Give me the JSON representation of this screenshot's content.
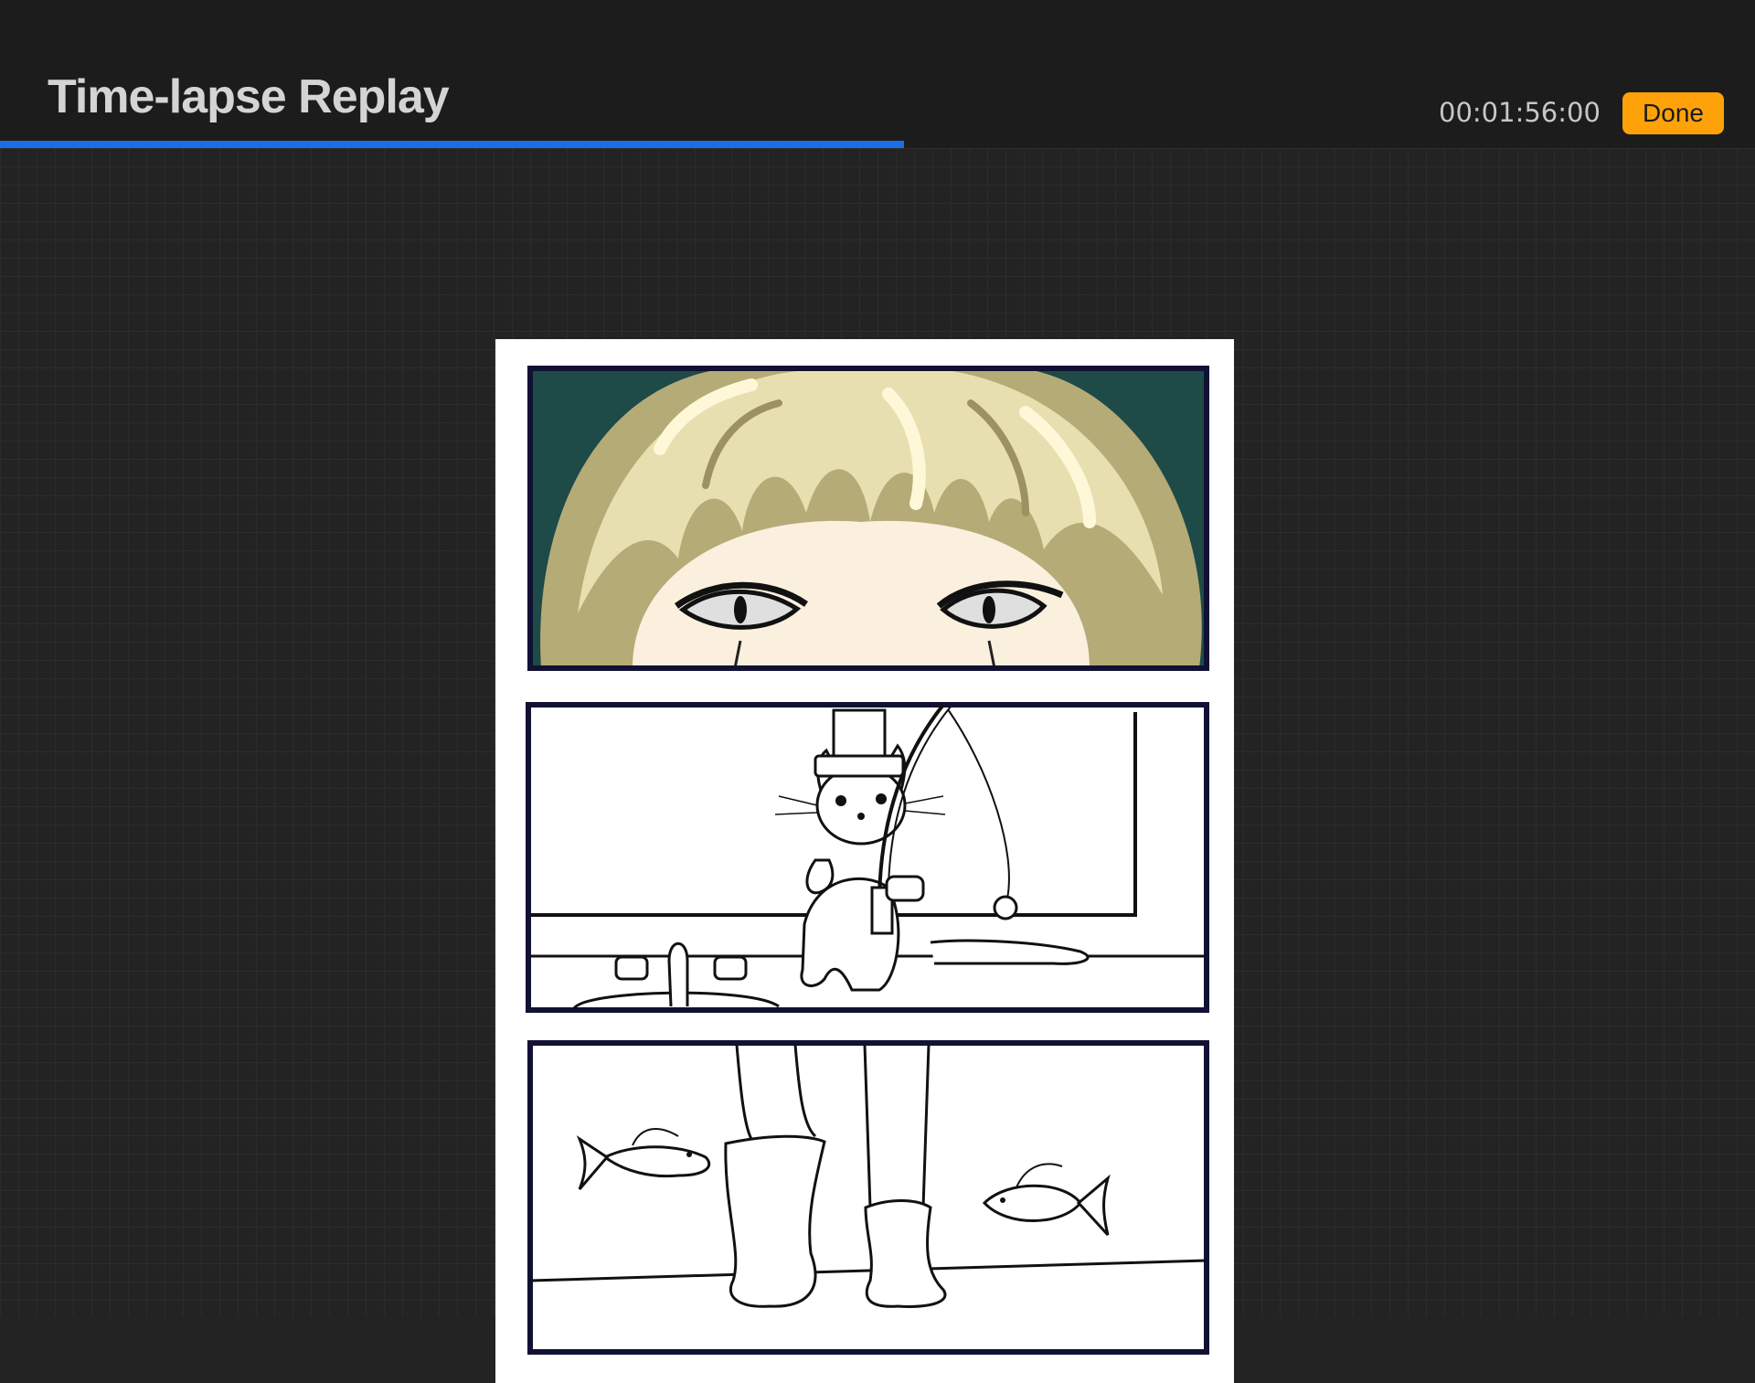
{
  "header": {
    "title": "Time-lapse Replay",
    "timestamp": "00:01:56:00",
    "done_label": "Done"
  },
  "playback": {
    "progress": 0.515
  },
  "colors": {
    "accent_progress": "#1a6fe6",
    "done_button": "#ffa20a",
    "panel_border": "#111133",
    "hair": "#e8dfb0",
    "panel1_background": "#1e4a47"
  },
  "icons": {}
}
